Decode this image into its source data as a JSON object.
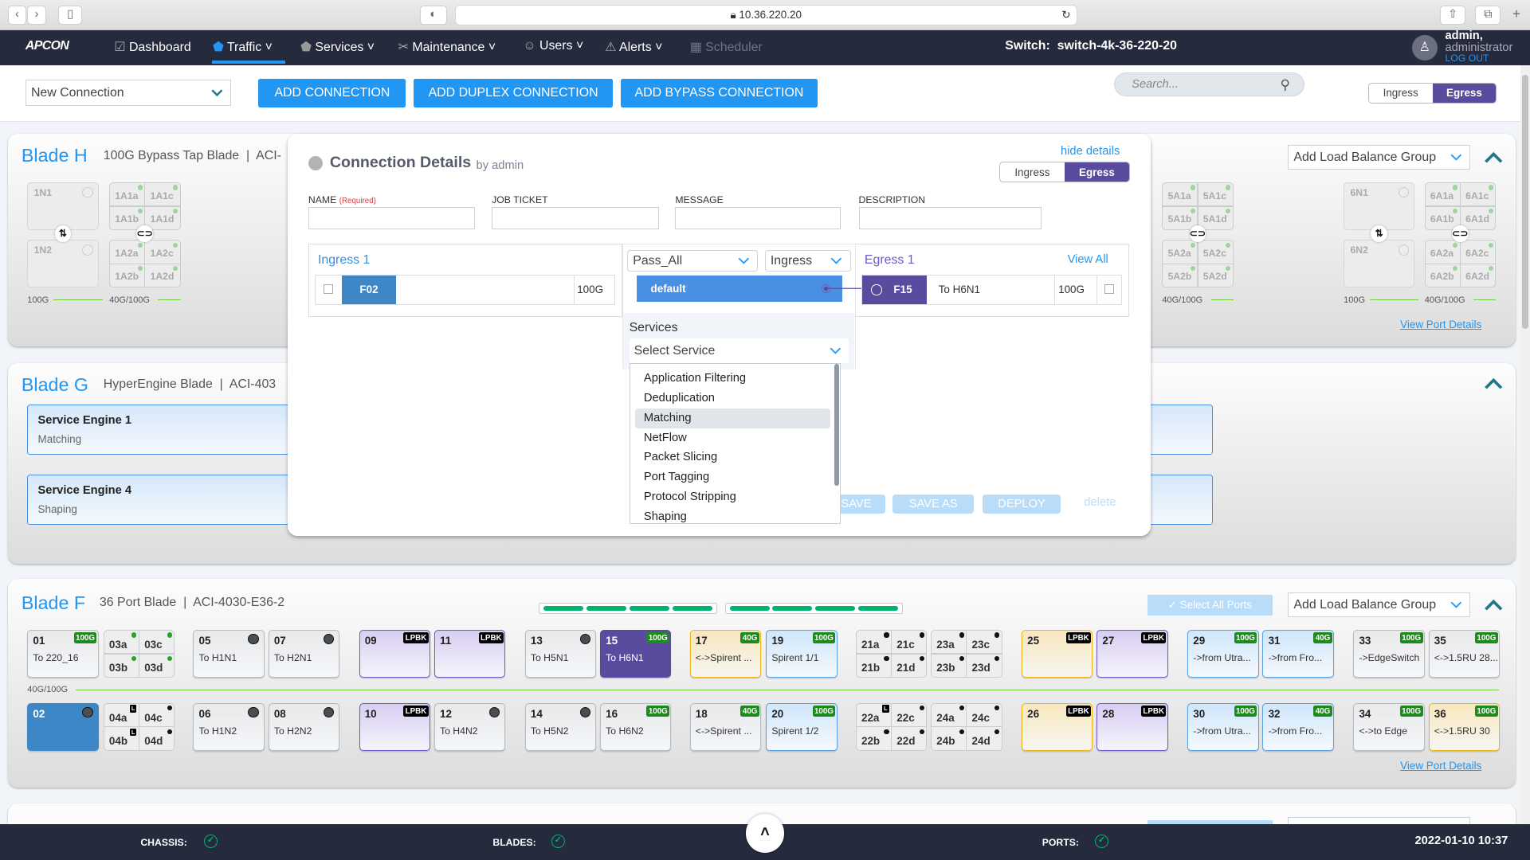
{
  "browser": {
    "url": "10.36.220.20"
  },
  "nav": {
    "logo": "APCON",
    "items": [
      {
        "label": "Dashboard",
        "icon": "chart-icon"
      },
      {
        "label": "Traffic",
        "icon": "traffic-icon",
        "active": true
      },
      {
        "label": "Services",
        "icon": "services-icon"
      },
      {
        "label": "Maintenance",
        "icon": "wrench-icon"
      },
      {
        "label": "Users",
        "icon": "users-icon"
      },
      {
        "label": "Alerts",
        "icon": "warning-icon"
      },
      {
        "label": "Scheduler",
        "icon": "calendar-icon",
        "disabled": true
      }
    ],
    "switch_label": "Switch:",
    "switch_name": "switch-4k-36-220-20",
    "user": "admin,",
    "role": "administrator",
    "logout": "LOG OUT"
  },
  "toolbar": {
    "connection_select": "New Connection",
    "add_connection": "ADD CONNECTION",
    "add_duplex": "ADD DUPLEX CONNECTION",
    "add_bypass": "ADD BYPASS CONNECTION",
    "search_placeholder": "Search...",
    "toggle": {
      "ingress": "Ingress",
      "egress": "Egress",
      "selected": "Egress"
    }
  },
  "blade_h": {
    "title": "Blade H",
    "subtitle": "100G Bypass Tap Blade",
    "model": "ACI-",
    "lb_group": "Add Load Balance Group",
    "view_port_details": "View Port Details",
    "groups": [
      {
        "n": [
          "1N1",
          "1N2"
        ],
        "q1": [
          "1A1a",
          "1A1c",
          "1A1b",
          "1A1d"
        ],
        "q2": [
          "1A2a",
          "1A2c",
          "1A2b",
          "1A2d"
        ],
        "speed_n": "100G",
        "speed_q": "40G/100G"
      },
      {
        "q1": [
          "5A1a",
          "5A1c",
          "5A1b",
          "5A1d"
        ],
        "q2": [
          "5A2a",
          "5A2c",
          "5A2b",
          "5A2d"
        ],
        "speed_q": "40G/100G"
      },
      {
        "n": [
          "6N1",
          "6N2"
        ],
        "q1": [
          "6A1a",
          "6A1c",
          "6A1b",
          "6A1d"
        ],
        "q2": [
          "6A2a",
          "6A2c",
          "6A2b",
          "6A2d"
        ],
        "speed_n": "100G",
        "speed_q": "40G/100G"
      }
    ]
  },
  "blade_g": {
    "title": "Blade G",
    "subtitle": "HyperEngine Blade",
    "model": "ACI-403",
    "engines": [
      {
        "name": "Service Engine 1",
        "service": "Matching"
      },
      {
        "name": "Service Engine 4",
        "service": "Shaping"
      }
    ]
  },
  "blade_f": {
    "title": "Blade F",
    "subtitle": "36 Port Blade",
    "model": "ACI-4030-E36-2",
    "select_all": "Select All Ports",
    "lb_group": "Add Load Balance Group",
    "speed_label": "40G/100G",
    "view_port_details": "View Port Details",
    "row1": [
      {
        "num": "01",
        "label": "To 220_16",
        "badge": "100G"
      },
      {
        "quad": [
          "03a",
          "03c",
          "03b",
          "03d"
        ],
        "marks": [
          "g",
          "g",
          "g",
          "g"
        ]
      },
      {
        "num": "05",
        "label": "To H1N1",
        "dot": true
      },
      {
        "num": "07",
        "label": "To H2N1",
        "dot": true
      },
      {
        "num": "09",
        "badge": "LPBK",
        "style": "purple"
      },
      {
        "num": "11",
        "badge": "LPBK",
        "style": "purple"
      },
      {
        "num": "13",
        "label": "To H5N1",
        "dot": true
      },
      {
        "num": "15",
        "label": "To H6N1",
        "badge": "100G",
        "style": "selpurple"
      },
      {
        "num": "17",
        "label": "<->Spirent ...",
        "badge": "40G",
        "style": "yellow"
      },
      {
        "num": "19",
        "label": "Spirent 1/1",
        "badge": "100G",
        "style": "blue"
      },
      {
        "quad": [
          "21a",
          "21c",
          "21b",
          "21d"
        ],
        "marks": [
          "d",
          "d",
          "d",
          "d"
        ]
      },
      {
        "quad": [
          "23a",
          "23c",
          "23b",
          "23d"
        ],
        "marks": [
          "d",
          "d",
          "d",
          "d"
        ]
      },
      {
        "num": "25",
        "badge": "LPBK",
        "style": "yellow"
      },
      {
        "num": "27",
        "badge": "LPBK",
        "style": "purple"
      },
      {
        "num": "29",
        "label": "->from Utra...",
        "badge": "100G",
        "style": "blue"
      },
      {
        "num": "31",
        "label": "->from Fro...",
        "badge": "40G",
        "style": "blue"
      },
      {
        "num": "33",
        "label": "->EdgeSwitch",
        "badge": "100G"
      },
      {
        "num": "35",
        "label": "<->1.5RU 28...",
        "badge": "100G"
      }
    ],
    "row2": [
      {
        "num": "02",
        "dot": true,
        "style": "selblue"
      },
      {
        "quad": [
          "04a",
          "04c",
          "04b",
          "04d"
        ],
        "marks": [
          "L",
          "d",
          "L",
          "d"
        ]
      },
      {
        "num": "06",
        "label": "To H1N2",
        "dot": true
      },
      {
        "num": "08",
        "label": "To H2N2",
        "dot": true
      },
      {
        "num": "10",
        "badge": "LPBK",
        "style": "purple"
      },
      {
        "num": "12",
        "label": "To H4N2",
        "dot": true
      },
      {
        "num": "14",
        "label": "To H5N2",
        "dot": true
      },
      {
        "num": "16",
        "label": "To H6N2",
        "badge": "100G"
      },
      {
        "num": "18",
        "label": "<->Spirent ...",
        "badge": "40G"
      },
      {
        "num": "20",
        "label": "Spirent 1/2",
        "badge": "100G",
        "style": "blue"
      },
      {
        "quad": [
          "22a",
          "22c",
          "22b",
          "22d"
        ],
        "marks": [
          "L",
          "d",
          "d",
          "d"
        ]
      },
      {
        "quad": [
          "24a",
          "24c",
          "24b",
          "24d"
        ],
        "marks": [
          "d",
          "d",
          "d",
          "d"
        ]
      },
      {
        "num": "26",
        "badge": "LPBK",
        "style": "yellow"
      },
      {
        "num": "28",
        "badge": "LPBK",
        "style": "purple"
      },
      {
        "num": "30",
        "label": "->from Utra...",
        "badge": "100G",
        "style": "blue"
      },
      {
        "num": "32",
        "label": "->from Fro...",
        "badge": "40G",
        "style": "blue"
      },
      {
        "num": "34",
        "label": "<->to Edge",
        "badge": "100G"
      },
      {
        "num": "36",
        "label": "<->1.5RU 30",
        "badge": "100G",
        "style": "yellow"
      }
    ]
  },
  "modal": {
    "title": "Connection Details",
    "by": "by admin",
    "hide_details": "hide details",
    "toggle": {
      "ingress": "Ingress",
      "egress": "Egress",
      "selected": "Egress"
    },
    "fields": {
      "name": "NAME",
      "required": "(Required)",
      "job_ticket": "JOB TICKET",
      "message": "MESSAGE",
      "description": "DESCRIPTION"
    },
    "ingress": {
      "title": "Ingress 1",
      "port": "F02",
      "speed": "100G"
    },
    "filter": {
      "select": "Pass_All",
      "direction": "Ingress",
      "item": "default"
    },
    "services": {
      "title": "Services",
      "placeholder": "Select Service",
      "options": [
        "Application Filtering",
        "Deduplication",
        "Matching",
        "NetFlow",
        "Packet Slicing",
        "Port Tagging",
        "Protocol Stripping",
        "Shaping"
      ],
      "highlighted": "Matching"
    },
    "egress": {
      "title": "Egress 1",
      "view_all": "View All",
      "port": "F15",
      "label": "To H6N1",
      "speed": "100G"
    },
    "buttons": {
      "save": "SAVE",
      "save_as": "SAVE AS",
      "deploy": "DEPLOY",
      "delete": "delete"
    }
  },
  "footer": {
    "chassis": "CHASSIS:",
    "blades": "BLADES:",
    "ports": "PORTS:",
    "datetime": "2022-01-10 10:37",
    "status_color": "#00b26f"
  },
  "colors": {
    "accent": "#2196f3",
    "egress_purple": "#5b4b9f",
    "nav_bg": "#252a3d"
  }
}
